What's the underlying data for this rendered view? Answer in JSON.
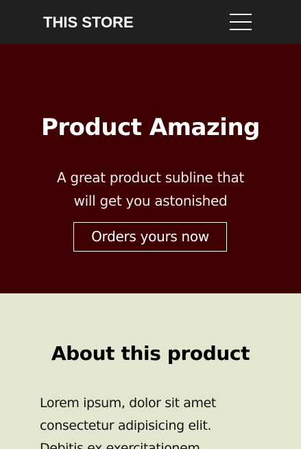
{
  "navbar": {
    "brand": "THIS STORE",
    "menu_icon": "hamburger-menu-icon"
  },
  "hero": {
    "title": "Product Amazing",
    "subtitle": "A great product subline that will get you astonished",
    "cta_label": "Orders yours now"
  },
  "about": {
    "title": "About this product",
    "body": "Lorem ipsum, dolor sit amet consectetur adipisicing elit. Debitis ex exercitationem"
  },
  "colors": {
    "navbar_bg": "#222121",
    "hero_bg": "#3f0001",
    "about_bg": "#e4e6d0",
    "text_light": "#ffffff",
    "text_dark": "#000000"
  }
}
